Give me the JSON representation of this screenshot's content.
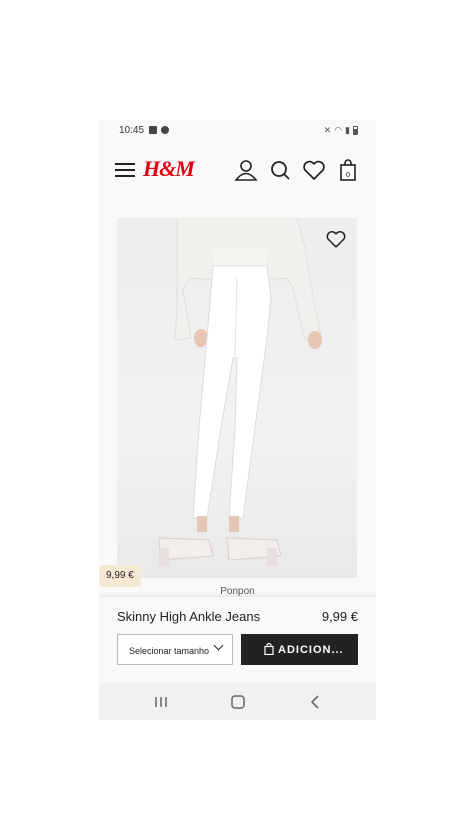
{
  "status_bar": {
    "time": "10:45"
  },
  "header": {
    "logo": "H&M",
    "icons": [
      "menu-icon",
      "account-icon",
      "search-icon",
      "favorites-icon",
      "shopping-bag-icon"
    ],
    "bag_count": "0"
  },
  "product": {
    "name": "Skinny High Ankle Jeans",
    "price": "9,99 €",
    "image_price_tag": "9,99 €",
    "cropped_label": "Ponpon"
  },
  "actions": {
    "size_select_label": "Selecionar tamanho",
    "add_button_label": "ADICION..."
  },
  "colors": {
    "brand": "#e50010",
    "button_bg": "#222222",
    "price_tag_bg": "#f6e9d3"
  }
}
